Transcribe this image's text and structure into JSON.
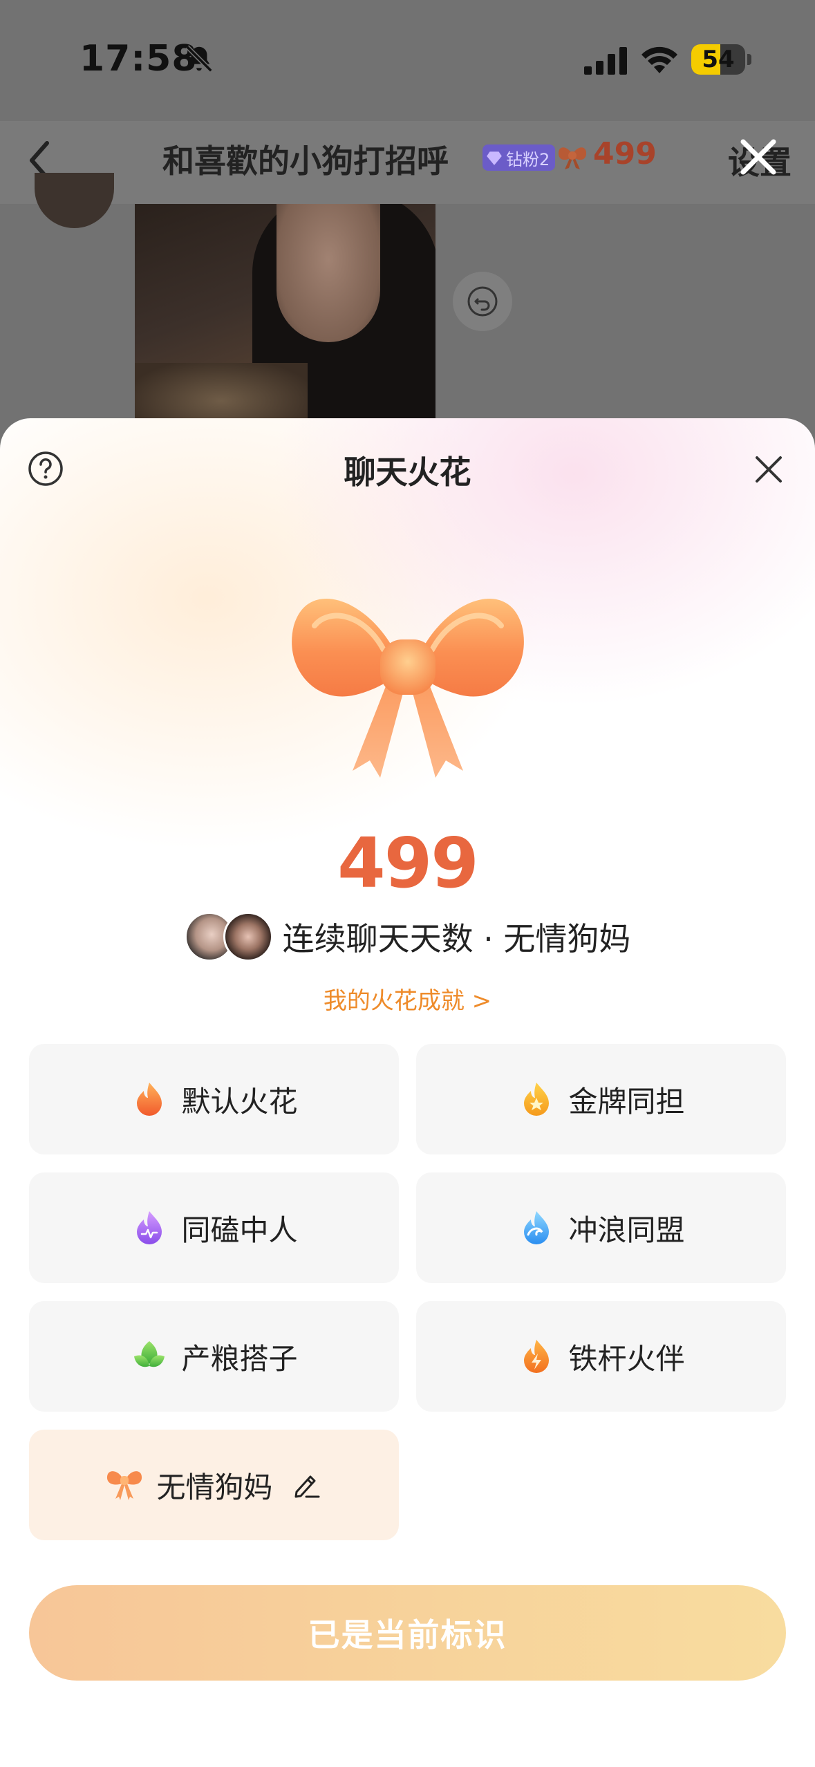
{
  "status_bar": {
    "time": "17:58",
    "battery": "54",
    "battery_level": 0.54,
    "icons": [
      "bell-off-icon",
      "signal-icon",
      "wifi-icon",
      "battery-icon"
    ]
  },
  "nav": {
    "title": "和喜歡的小狗打招呼",
    "fan_badge": "钻粉2",
    "spark_count": "499",
    "settings": "设置",
    "icons": [
      "back-icon",
      "diamond-icon",
      "bow-icon",
      "close-x-icon"
    ]
  },
  "sheet": {
    "title": "聊天火花",
    "streak_count": "499",
    "streak_label": "连续聊天天数 · 无情狗妈",
    "achievement_link": "我的火花成就 >",
    "identities": [
      {
        "label": "默认火花",
        "icon": "flame-orange-icon",
        "selected": false
      },
      {
        "label": "金牌同担",
        "icon": "flame-gold-star-icon",
        "selected": false
      },
      {
        "label": "同磕中人",
        "icon": "flame-purple-icon",
        "selected": false
      },
      {
        "label": "冲浪同盟",
        "icon": "flame-blue-wave-icon",
        "selected": false
      },
      {
        "label": "产粮搭子",
        "icon": "leaf-green-icon",
        "selected": false
      },
      {
        "label": "铁杆火伴",
        "icon": "flame-lightning-icon",
        "selected": false
      },
      {
        "label": "无情狗妈",
        "icon": "bow-icon",
        "selected": true
      }
    ],
    "confirm_button": "已是当前标识"
  },
  "colors": {
    "accent": "#e8673f",
    "link": "#ee8b2a",
    "button_gradient_start": "#f7c698",
    "button_gradient_end": "#f8dc9f",
    "selected_card": "#fdf0e4"
  }
}
